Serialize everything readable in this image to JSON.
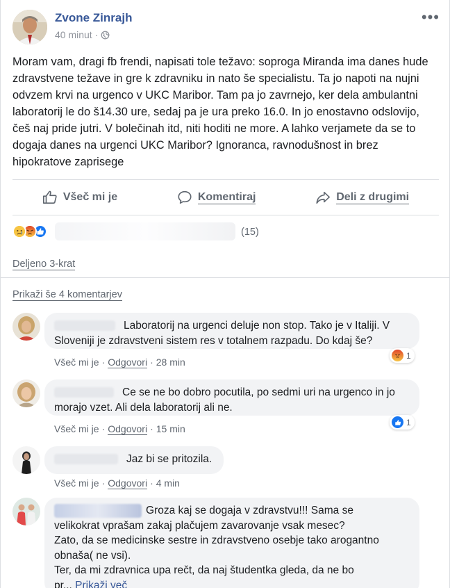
{
  "post": {
    "author": "Zvone Zinrajh",
    "time": "40 minut",
    "privacy_icon": "globe-icon",
    "text": "Moram vam, dragi fb frendi, napisati tole težavo: soproga Miranda ima danes hude zdravstvene težave in gre k zdravniku in nato še specialistu. Ta jo napoti na nujni odvzem krvi na urgenco v UKC Maribor. Tam pa jo zavrnejo, ker dela ambulantni laboratorij le do š14.30 ure, sedaj pa je ura preko 16.0. In jo enostavno odslovijo, češ naj pride jutri. V bolečinah itd, niti hoditi ne more. A lahko verjamete da se to dogaja danes na urgenci UKC Maribor? Ignoranca, ravnodušnost in brez hipokratove zaprisege"
  },
  "actions": {
    "like": "Všeč mi je",
    "comment": "Komentiraj",
    "share": "Deli z drugimi"
  },
  "reactions": {
    "count": "(15)",
    "types": [
      "sad",
      "angry",
      "like"
    ]
  },
  "shared": "Deljeno 3-krat",
  "more_comments": "Prikaži še 4 komentarjev",
  "comments": [
    {
      "text": "Laboratorij na urgenci deluje non stop. Tako je v Italiji. V Sloveniji je zdravstveni sistem res v totalnem razpadu. Do kdaj še?",
      "like": "Všeč mi je",
      "reply": "Odgovori",
      "time": "28 min",
      "reaction_count": "1",
      "reaction_type": "angry"
    },
    {
      "text": "Ce se ne bo dobro pocutila, po sedmi uri na urgenco in jo morajo vzet. Ali dela laboratorij ali ne.",
      "like": "Všeč mi je",
      "reply": "Odgovori",
      "time": "15 min",
      "reaction_count": "1",
      "reaction_type": "like"
    },
    {
      "text": "Jaz bi se pritozila.",
      "like": "Všeč mi je",
      "reply": "Odgovori",
      "time": "4 min"
    },
    {
      "text_lines": [
        "Groza kaj se dogaja v zdravstvu!!! Sama se",
        "velikokrat vprašam zakaj plačujem zavarovanje vsak mesec?",
        "Zato, da se medicinske sestre in zdravstveno osebje tako arogantno",
        "obnaša( ne vsi).",
        "Ter, da mi zdravnica upa rečt, da naj študentka gleda, da ne bo",
        "pr..."
      ],
      "see_more": "Prikaži več"
    }
  ],
  "colors": {
    "link": "#385898",
    "secondary": "#606770",
    "bubble": "#f2f3f5",
    "like_blue": "#1877f2"
  }
}
